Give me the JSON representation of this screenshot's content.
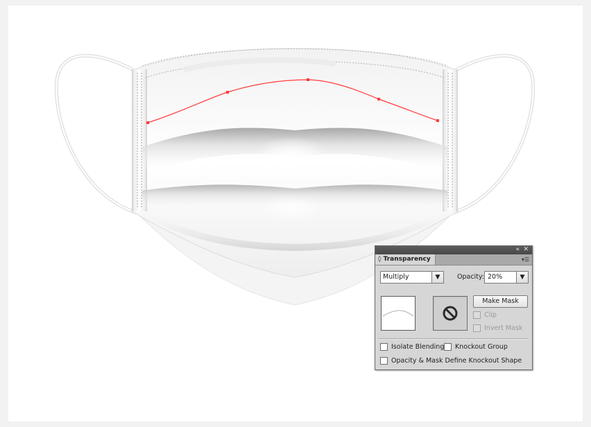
{
  "panel": {
    "title": "Transparency",
    "tab_prefix_icon": "double-arrow-icon",
    "menu_icon": "panel-menu-icon",
    "collapse_icon": "collapse-icon",
    "close_icon": "close-icon",
    "blend_mode": "Multiply",
    "opacity_label": "Opacity:",
    "opacity_value": "20%",
    "make_mask_label": "Make Mask",
    "clip_label": "Clip",
    "invert_mask_label": "Invert Mask",
    "isolate_blending_label": "Isolate Blending",
    "knockout_group_label": "Knockout Group",
    "opacity_mask_label": "Opacity & Mask Define Knockout Shape"
  },
  "colors": {
    "path_stroke": "#ff3b3b",
    "panel_bg": "#d6d6d6",
    "panel_topbar": "#4f4f4f"
  }
}
